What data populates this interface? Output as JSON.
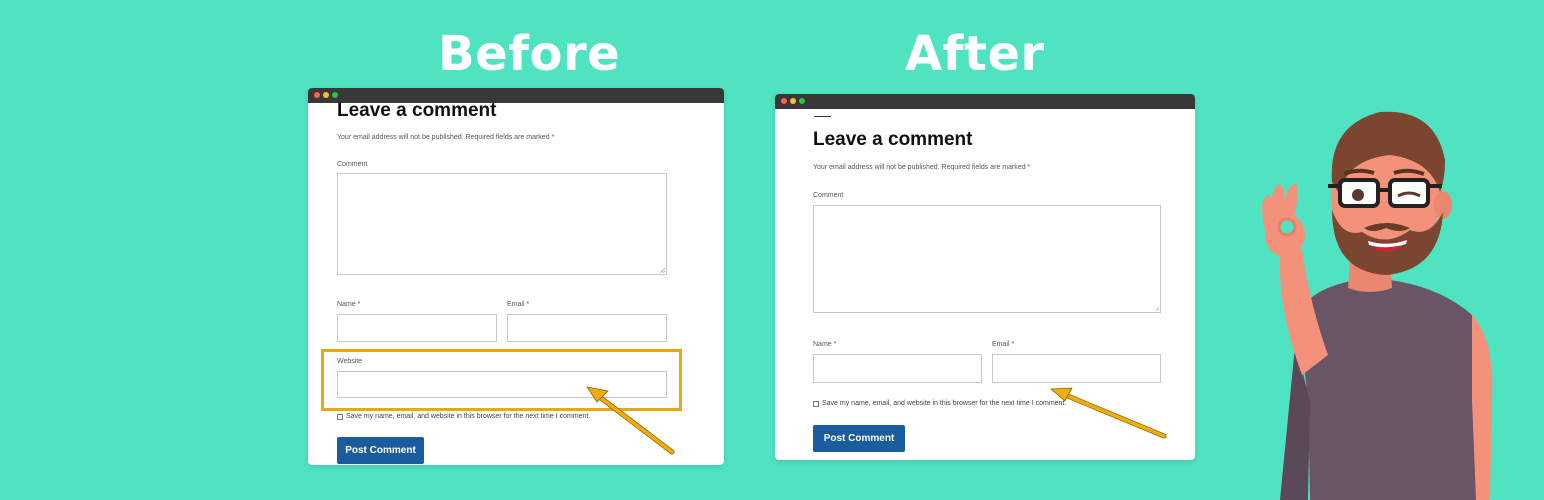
{
  "colors": {
    "background": "#50e3c2",
    "button": "#1b5c9e",
    "highlight": "#e7a90c",
    "titlebar": "#383838"
  },
  "before": {
    "heading": "Before",
    "form": {
      "title": "Leave a comment",
      "notice": "Your email address will not be published. Required fields are marked *",
      "comment_label": "Comment",
      "name_label": "Name *",
      "email_label": "Email *",
      "website_label": "Website",
      "save_label": "Save my name, email, and website in this browser for the next time I comment.",
      "submit_label": "Post Comment"
    }
  },
  "after": {
    "heading": "After",
    "form": {
      "title": "Leave a comment",
      "notice": "Your email address will not be published. Required fields are marked *",
      "comment_label": "Comment",
      "name_label": "Name *",
      "email_label": "Email *",
      "save_label": "Save my name, email, and website in this browser for the next time I comment.",
      "submit_label": "Post Comment"
    }
  },
  "icons": {
    "window_controls": [
      "close-dot",
      "minimize-dot",
      "maximize-dot"
    ],
    "arrow": "arrow-icon",
    "mascot": "bearded-man-ok-gesture-illustration"
  }
}
